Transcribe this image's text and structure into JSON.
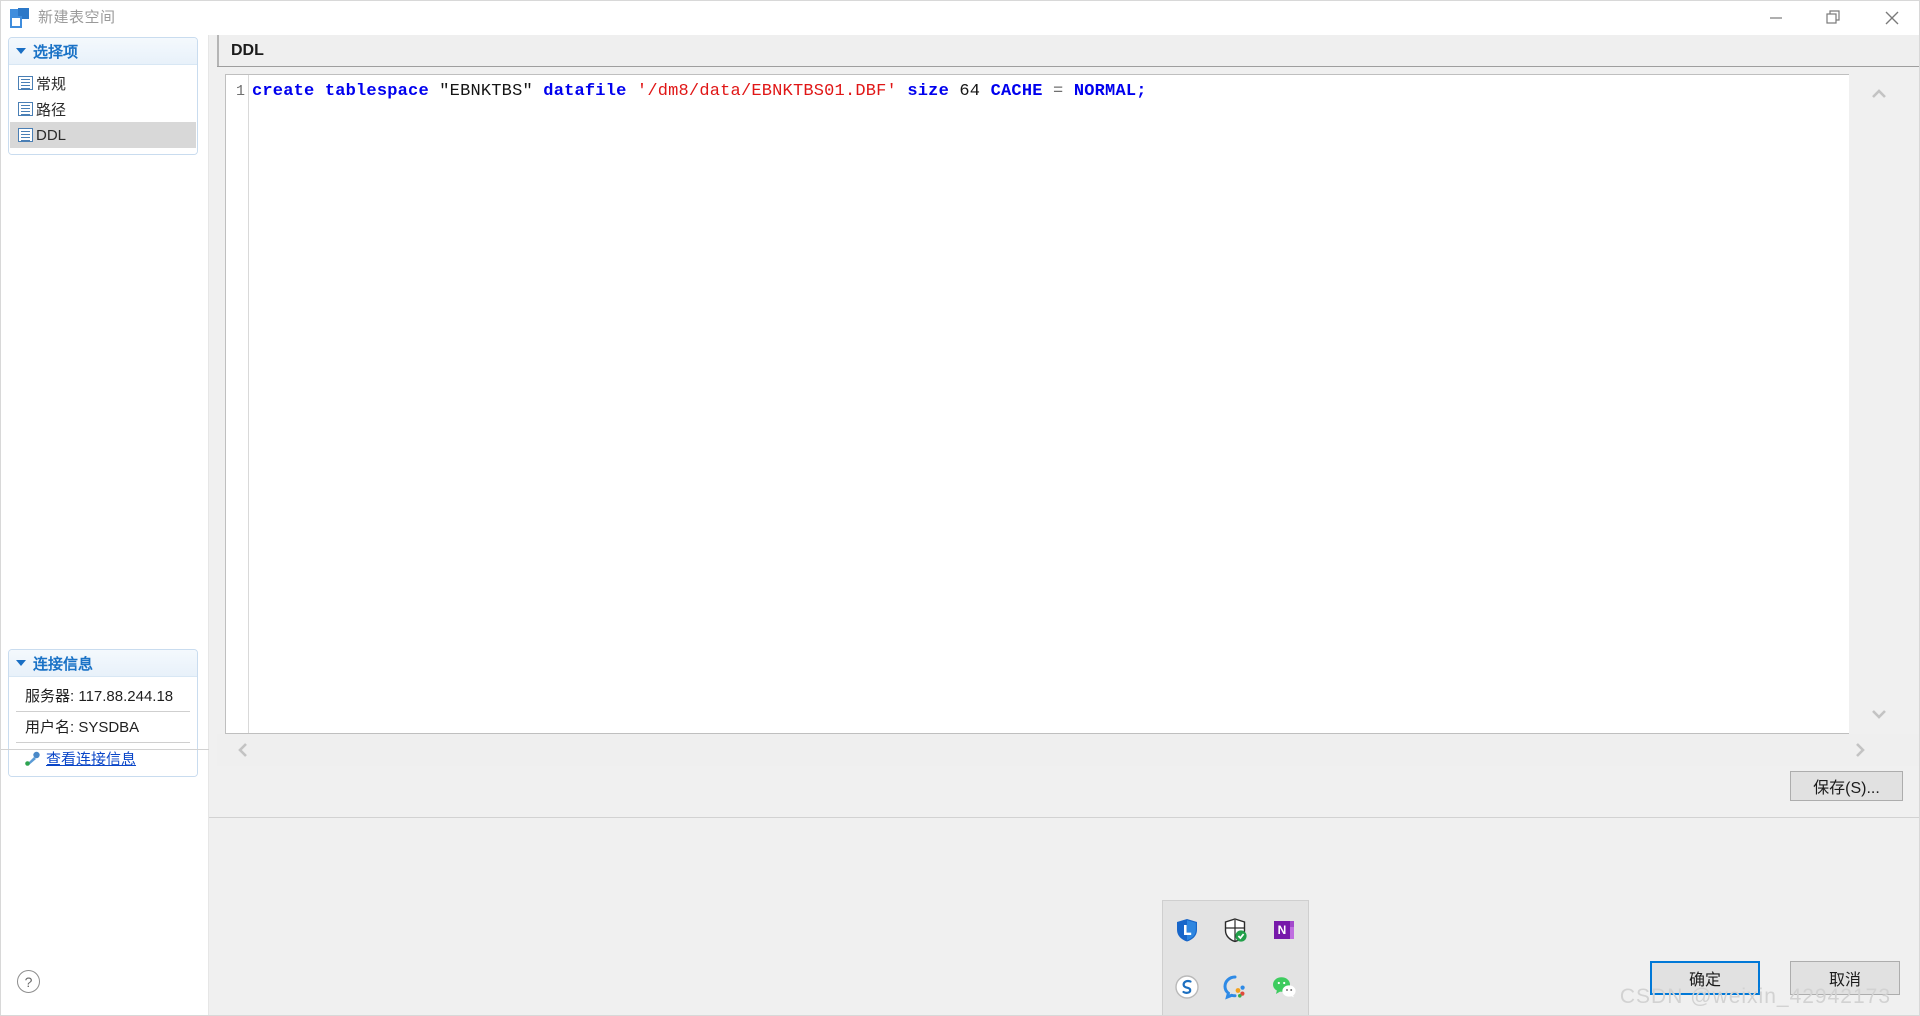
{
  "window": {
    "title": "新建表空间",
    "icon": "tablespace-icon",
    "controls": {
      "minimize": "minimize-icon",
      "restore": "restore-icon",
      "close": "close-icon"
    }
  },
  "sidebar": {
    "options_panel": {
      "title": "选择项",
      "collapsed": false,
      "items": [
        {
          "label": "常规",
          "icon": "page-icon",
          "selected": false
        },
        {
          "label": "路径",
          "icon": "page-icon",
          "selected": false
        },
        {
          "label": "DDL",
          "icon": "page-icon",
          "selected": true
        }
      ]
    },
    "connection_panel": {
      "title": "连接信息",
      "collapsed": false,
      "server_label": "服务器: 117.88.244.18",
      "user_label": "用户名: SYSDBA",
      "view_link": "查看连接信息",
      "link_icon": "connection-icon"
    },
    "help_button": "?"
  },
  "main": {
    "header": "DDL",
    "editor": {
      "line_numbers": [
        "1"
      ],
      "code_line": "create tablespace \"EBNKTBS\" datafile '/dm8/data/EBNKTBS01.DBF' size 64 CACHE = NORMAL;",
      "tokens": [
        {
          "text": "create",
          "kind": "keyword"
        },
        {
          "text": " ",
          "kind": "plain"
        },
        {
          "text": "tablespace",
          "kind": "keyword"
        },
        {
          "text": " ",
          "kind": "plain"
        },
        {
          "text": "\"EBNKTBS\"",
          "kind": "identifier"
        },
        {
          "text": " ",
          "kind": "plain"
        },
        {
          "text": "datafile",
          "kind": "keyword"
        },
        {
          "text": " ",
          "kind": "plain"
        },
        {
          "text": "'/dm8/data/EBNKTBS01.DBF'",
          "kind": "string"
        },
        {
          "text": " ",
          "kind": "plain"
        },
        {
          "text": "size",
          "kind": "keyword"
        },
        {
          "text": " ",
          "kind": "plain"
        },
        {
          "text": "64",
          "kind": "number"
        },
        {
          "text": " ",
          "kind": "plain"
        },
        {
          "text": "CACHE",
          "kind": "keyword"
        },
        {
          "text": " ",
          "kind": "plain"
        },
        {
          "text": "=",
          "kind": "operator"
        },
        {
          "text": " ",
          "kind": "plain"
        },
        {
          "text": "NORMAL",
          "kind": "keyword"
        },
        {
          "text": ";",
          "kind": "keyword"
        }
      ]
    },
    "scrollbars": {
      "vertical_up": "chevron-up-icon",
      "vertical_down": "chevron-down-icon",
      "horizontal_left": "chevron-left-icon",
      "horizontal_right": "chevron-right-icon"
    },
    "save_button": "保存(S)..."
  },
  "footer": {
    "ok_button": "确定",
    "cancel_button": "取消"
  },
  "tray_popup": {
    "icons": [
      {
        "name": "lenovo-shield-icon",
        "label": "L"
      },
      {
        "name": "windows-security-shield-icon",
        "label": ""
      },
      {
        "name": "onenote-icon",
        "label": "N"
      },
      {
        "name": "sogou-input-icon",
        "label": "S"
      },
      {
        "name": "qq-browser-icon",
        "label": ""
      },
      {
        "name": "wechat-icon",
        "label": ""
      }
    ]
  },
  "watermark": "CSDN @weixin_42942173",
  "colors": {
    "accent": "#0078d7",
    "panel_title": "#1a72c6",
    "keyword": "#0000ee",
    "string": "#e01616",
    "link": "#0a46c8"
  }
}
